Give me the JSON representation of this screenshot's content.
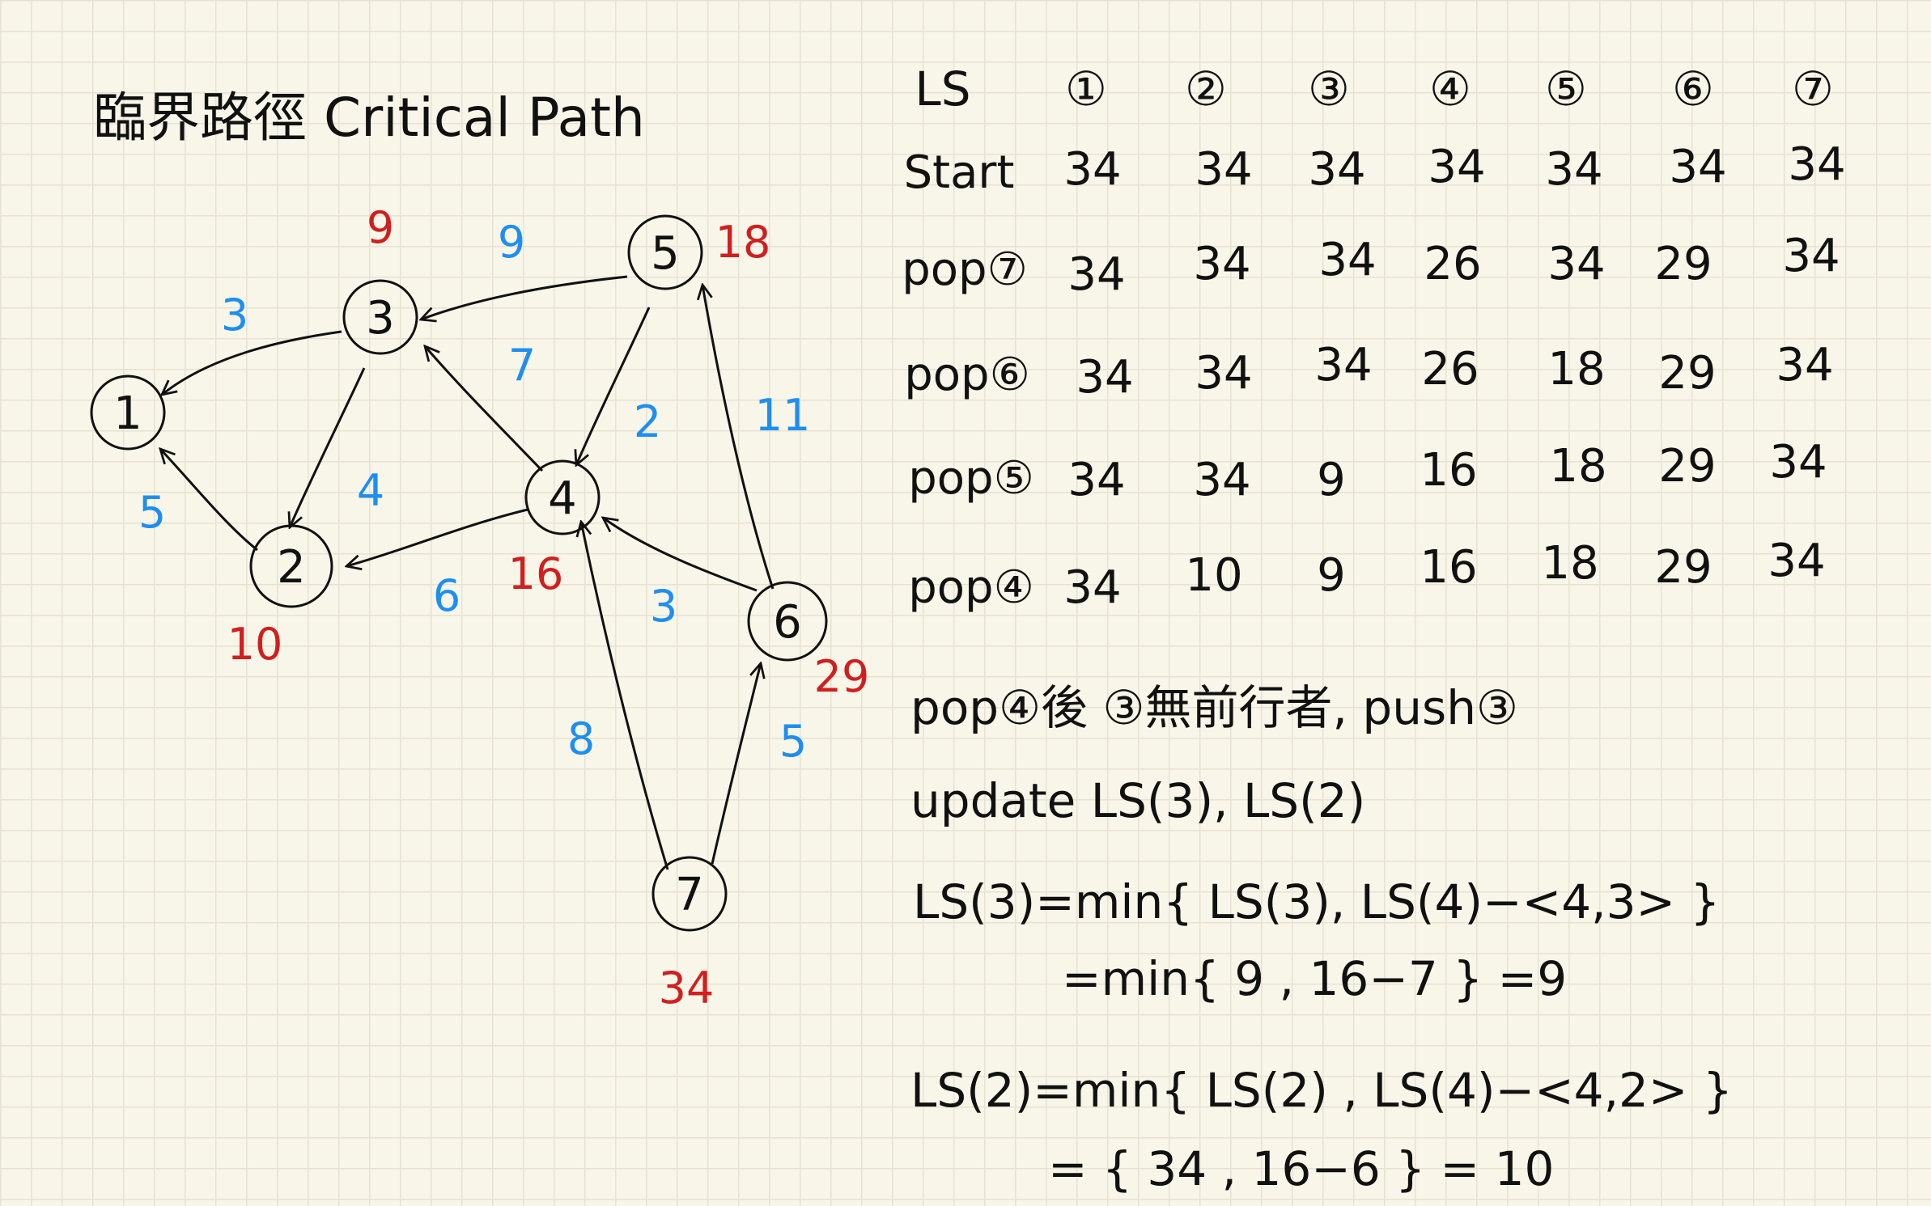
{
  "title": "臨界路徑 Critical Path",
  "colors": {
    "ink": "#111111",
    "weight": "#1f8ef1",
    "ls": "#d01f1f"
  },
  "graph": {
    "nodes": [
      {
        "id": "1",
        "label": "1",
        "ls": ""
      },
      {
        "id": "2",
        "label": "2",
        "ls": "10"
      },
      {
        "id": "3",
        "label": "3",
        "ls": "9"
      },
      {
        "id": "4",
        "label": "4",
        "ls": "16"
      },
      {
        "id": "5",
        "label": "5",
        "ls": "18"
      },
      {
        "id": "6",
        "label": "6",
        "ls": "29"
      },
      {
        "id": "7",
        "label": "7",
        "ls": "34"
      }
    ],
    "edges": [
      {
        "from": "3",
        "to": "1",
        "weight": "3"
      },
      {
        "from": "2",
        "to": "1",
        "weight": "5"
      },
      {
        "from": "5",
        "to": "3",
        "weight": "9"
      },
      {
        "from": "3",
        "to": "2",
        "weight": "4"
      },
      {
        "from": "4",
        "to": "3",
        "weight": "7"
      },
      {
        "from": "5",
        "to": "4",
        "weight": "2"
      },
      {
        "from": "4",
        "to": "2",
        "weight": "6"
      },
      {
        "from": "6",
        "to": "5",
        "weight": "11"
      },
      {
        "from": "6",
        "to": "4",
        "weight": "3"
      },
      {
        "from": "7",
        "to": "4",
        "weight": "8"
      },
      {
        "from": "7",
        "to": "6",
        "weight": "5"
      }
    ]
  },
  "table": {
    "header": [
      "LS",
      "①",
      "②",
      "③",
      "④",
      "⑤",
      "⑥",
      "⑦"
    ],
    "rows": [
      [
        "Start",
        "34",
        "34",
        "34",
        "34",
        "34",
        "34",
        "34"
      ],
      [
        "pop⑦",
        "34",
        "34",
        "34",
        "26",
        "34",
        "29",
        "34"
      ],
      [
        "pop⑥",
        "34",
        "34",
        "34",
        "26",
        "18",
        "29",
        "34"
      ],
      [
        "pop⑤",
        "34",
        "34",
        "9",
        "16",
        "18",
        "29",
        "34"
      ],
      [
        "pop④",
        "34",
        "10",
        "9",
        "16",
        "18",
        "29",
        "34"
      ]
    ]
  },
  "notes": {
    "line1": "pop④後 ③無前行者, push③",
    "line2": "update LS(3), LS(2)",
    "line3": "LS(3)=min{ LS(3), LS(4)−<4,3> }",
    "line4": "=min{  9 , 16−7 } =9",
    "line5": "LS(2)=min{ LS(2) , LS(4)−<4,2> }",
    "line6": "= {  34 , 16−6 } = 10"
  }
}
